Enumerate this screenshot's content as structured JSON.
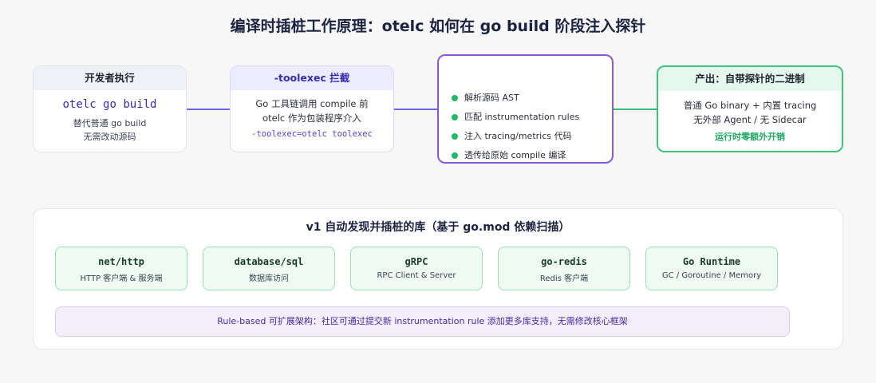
{
  "title": "编译时插桩工作原理：otelc 如何在 go build 阶段注入探针",
  "flow": {
    "dev": {
      "header": "开发者执行",
      "command": "otelc go build",
      "lines": [
        "替代普通 go build",
        "无需改动源码"
      ]
    },
    "toolexec": {
      "header": "-toolexec 拦截",
      "lines": [
        "Go 工具链调用 compile 前",
        "otelc 作为包装程序介入"
      ],
      "code": "-toolexec=otelc toolexec"
    },
    "process": {
      "steps": [
        "解析源码 AST",
        "匹配 instrumentation rules",
        "注入 tracing/metrics 代码",
        "透传给原始 compile 编译"
      ]
    },
    "output": {
      "header": "产出：自带探针的二进制",
      "lines": [
        "普通 Go binary + 内置 tracing",
        "无外部 Agent / 无 Sidecar"
      ],
      "highlight": "运行时零额外开销"
    }
  },
  "libraries": {
    "title": "v1 自动发现并插桩的库（基于 go.mod 依赖扫描）",
    "items": [
      {
        "name": "net/http",
        "desc": "HTTP 客户端 & 服务端"
      },
      {
        "name": "database/sql",
        "desc": "数据库访问"
      },
      {
        "name": "gRPC",
        "desc": "RPC Client & Server"
      },
      {
        "name": "go-redis",
        "desc": "Redis 客户端"
      },
      {
        "name": "Go Runtime",
        "desc": "GC / Goroutine / Memory"
      }
    ],
    "note": "Rule-based 可扩展架构：社区可通过提交新 instrumentation rule 添加更多库支持，无需修改核心框架"
  },
  "colors": {
    "accent_purple": "#6c69e0",
    "accent_green": "#2fbf79",
    "process_border": "#8a57d6"
  }
}
